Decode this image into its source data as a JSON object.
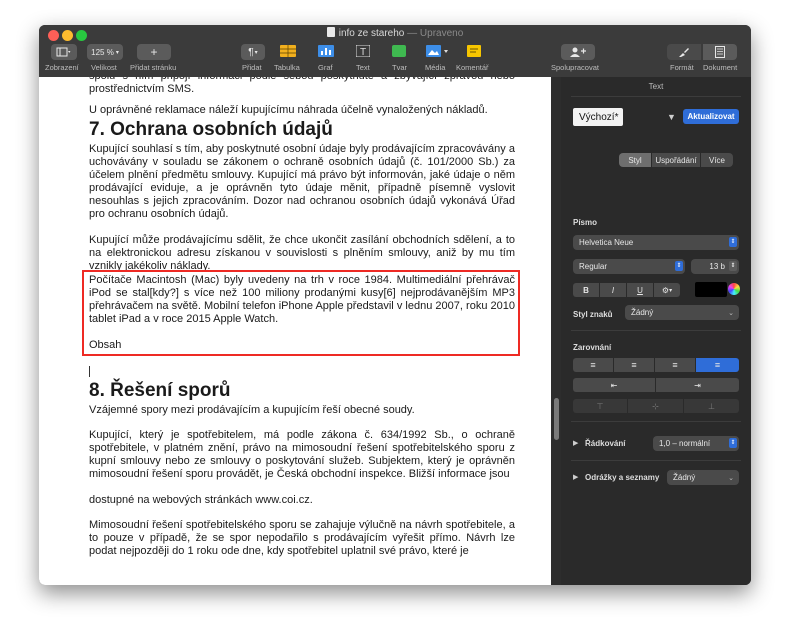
{
  "window": {
    "title": "info ze stareho",
    "title_sep": "—",
    "title_status": "Upraveno"
  },
  "toolbar": {
    "zoom_value": "125 %",
    "buttons": {
      "zobrazeni": "Zobrazení",
      "velikost": "Velikost",
      "pridat_stranku": "Přidat stránku",
      "pridat": "Přidat",
      "tabulka": "Tabulka",
      "graf": "Graf",
      "text": "Text",
      "tvar": "Tvar",
      "media": "Média",
      "komentar": "Komentář",
      "spolupracovat": "Spolupracovat",
      "format": "Formát",
      "dokument": "Dokument"
    }
  },
  "document": {
    "para_top": "spolu s ním připojí informaci podle sebou poskytnuté a zbývající zprávou nebo prostřednictvím SMS.",
    "para_reklamace": "U oprávněné reklamace náleží kupujícímu náhrada účelně vynaložených nákladů.",
    "heading_7": "7. Ochrana osobních údajů",
    "para_7a": "Kupující souhlasí s tím, aby poskytnuté osobní údaje byly prodávajícím zpracovávány a uchovávány v souladu se zákonem o ochraně osobních údajů (č. 101/2000 Sb.) za účelem plnění předmětu smlouvy. Kupující má právo být informován, jaké údaje o něm prodávající eviduje, a je oprávněn tyto údaje měnit, případně písemně vyslovit nesouhlas s jejich zpracováním. Dozor nad ochranou osobních údajů vykonává Úřad pro ochranu osobních údajů.",
    "para_7b": "Kupující může prodávajícímu sdělit, že chce ukončit zasílání obchodních sdělení, a to na elektronickou adresu získanou v souvislosti s plněním smlouvy, aniž by mu tím vznikly jakékoliv náklady.",
    "para_inserted": "Počítače Macintosh (Mac) byly uvedeny na trh v roce 1984. Multimediální přehrávač iPod se stal[kdy?] s více než 100 miliony prodanými kusy[6] nejprodávanějším MP3 přehrávačem na světě. Mobilní telefon iPhone Apple představil v lednu 2007, roku 2010 tablet iPad a v roce 2015 Apple Watch.",
    "obsah": "Obsah",
    "heading_8": "8. Řešení sporů",
    "para_8a": "Vzájemné spory mezi prodávajícím a kupujícím řeší obecné soudy.",
    "para_8b": "Kupující, který je spotřebitelem, má podle zákona č. 634/1992 Sb., o ochraně spotřebitele, v platném znění, právo na mimosoudní řešení spotřebitelského sporu z kupní smlouvy nebo ze smlouvy o poskytování služeb. Subjektem, který je oprávněn mimosoudní řešení sporu provádět, je Česká obchodní inspekce. Bližší informace jsou",
    "para_8b_end": "dostupné na webových stránkách www.coi.cz.",
    "para_8c": "Mimosoudní řešení spotřebitelského sporu se zahajuje výlučně na návrh spotřebitele, a to pouze v případě, že se spor nepodařilo s prodávajícím vyřešit přímo. Návrh lze podat nejpozději do 1 roku ode dne, kdy spotřebitel uplatnil své právo, které je"
  },
  "sidebar": {
    "header": "Text",
    "style_name": "Výchozí*",
    "update_button": "Aktualizovat",
    "tabs": [
      "Styl",
      "Uspořádání",
      "Více"
    ],
    "font_section": "Písmo",
    "font_family": "Helvetica Neue",
    "font_style": "Regular",
    "font_size": "13 b",
    "format_buttons": [
      "B",
      "I",
      "U"
    ],
    "char_style_label": "Styl znaků",
    "char_style_value": "Žádný",
    "alignment_section": "Zarovnání",
    "line_spacing_label": "Řádkování",
    "line_spacing_value": "1,0 – normální",
    "bullets_label": "Odrážky a seznamy",
    "bullets_value": "Žádný",
    "colors": {
      "accent": "#2f6dd8",
      "selection_box": "#ee2a24",
      "text_color_swatch": "#000000"
    }
  }
}
